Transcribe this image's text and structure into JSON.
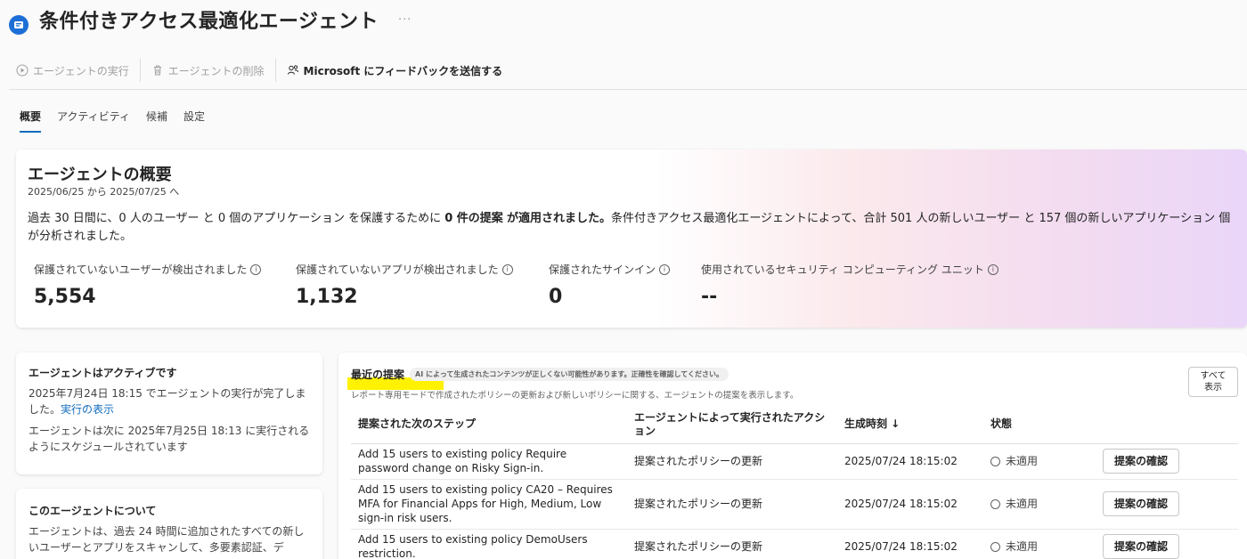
{
  "header": {
    "title": "条件付きアクセス最適化エージェント",
    "more": "···",
    "icon": "agent-app-icon",
    "accent": "#1d6fd6"
  },
  "toolbar": {
    "run_label": "エージェントの実行",
    "delete_label": "エージェントの削除",
    "feedback_label": "Microsoft にフィードバックを送信する"
  },
  "tabs": [
    {
      "label": "概要",
      "active": true
    },
    {
      "label": "アクティビティ",
      "active": false
    },
    {
      "label": "候補",
      "active": false
    },
    {
      "label": "設定",
      "active": false
    }
  ],
  "overview": {
    "title": "エージェントの概要",
    "date_range": "2025/06/25 から 2025/07/25 へ",
    "summary_part1": "過去 30 日間に、0 人のユーザー と 0 個のアプリケーション を保護するために ",
    "summary_bold1": "0 件の提案",
    "summary_part2": " ",
    "summary_bold2": "が適用されました。",
    "summary_part3": "条件付きアクセス最適化エージェントによって、合計 501 人の新しいユーザー と 157 個の新しいアプリケーション 個が分析されました。",
    "metrics": [
      {
        "label": "保護されていないユーザーが検出されました",
        "value": "5,554"
      },
      {
        "label": "保護されていないアプリが検出されました",
        "value": "1,132"
      },
      {
        "label": "保護されたサインイン",
        "value": "0"
      },
      {
        "label": "使用されているセキュリティ コンピューティング ユニット",
        "value": "--"
      }
    ]
  },
  "status_card": {
    "title": "エージェントはアクティブです",
    "text1": "2025年7月24日 18:15 でエージェントの実行が完了しました。",
    "link": "実行の表示",
    "text2": "エージェントは次に 2025年7月25日 18:13 に実行されるようにスケジュールされています"
  },
  "about_card": {
    "title": "このエージェントについて",
    "text": "エージェントは、過去 24 時間に追加されたすべての新しいユーザーとアプリをスキャンして、多要素認証、デ"
  },
  "recommendations": {
    "title": "最近の提案",
    "ai_note": "AI によって生成されたコンテンツが正しくない可能性があります。正確性を確認してください。",
    "subtitle": "レポート専用モードで作成されたポリシーの更新および新しいポリシーに関する、エージェントの提案を表示します。",
    "view_all": [
      "すべて",
      "表示"
    ],
    "columns": [
      "提案された次のステップ",
      "エージェントによって実行されたアクション",
      "生成時刻 ↓",
      "状態",
      ""
    ],
    "rows": [
      {
        "step": "Add 15 users to existing policy Require password change on Risky Sign-in.",
        "action": "提案されたポリシーの更新",
        "time": "2025/07/24 18:15:02",
        "state": "未適用",
        "button": "提案の確認"
      },
      {
        "step": "Add 15 users to existing policy CA20 – Requires MFA for Financial Apps for High, Medium, Low sign-in risk users.",
        "action": "提案されたポリシーの更新",
        "time": "2025/07/24 18:15:02",
        "state": "未適用",
        "button": "提案の確認"
      },
      {
        "step": "Add 15 users to existing policy DemoUsers restriction.",
        "action": "提案されたポリシーの更新",
        "time": "2025/07/24 18:15:02",
        "state": "未適用",
        "button": "提案の確認"
      }
    ]
  }
}
